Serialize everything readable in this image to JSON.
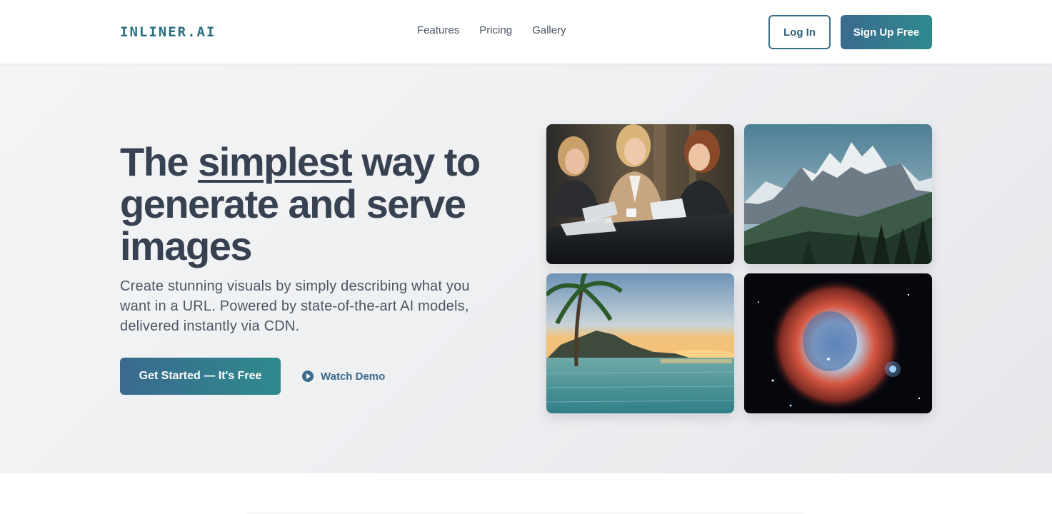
{
  "header": {
    "logo": "INLINER.AI",
    "nav": [
      "Features",
      "Pricing",
      "Gallery"
    ],
    "login_label": "Log In",
    "signup_label": "Sign Up Free"
  },
  "hero": {
    "headline_pre": "The ",
    "headline_emphasis": "simplest",
    "headline_post": " way to generate and serve images",
    "subtext": "Create stunning visuals by simply describing what you want in a URL. Powered by state-of-the-art AI models, delivered instantly via CDN.",
    "cta_primary": "Get Started — It's Free",
    "cta_secondary": "Watch Demo"
  },
  "gallery": {
    "images": [
      "business-meeting-image",
      "mountain-landscape-image",
      "tropical-beach-image",
      "nebula-image"
    ]
  },
  "colors": {
    "accent_start": "#3a6a8e",
    "accent_end": "#2e8a8d",
    "text_dark": "#374151",
    "hero_bg": "#eef0f2"
  }
}
